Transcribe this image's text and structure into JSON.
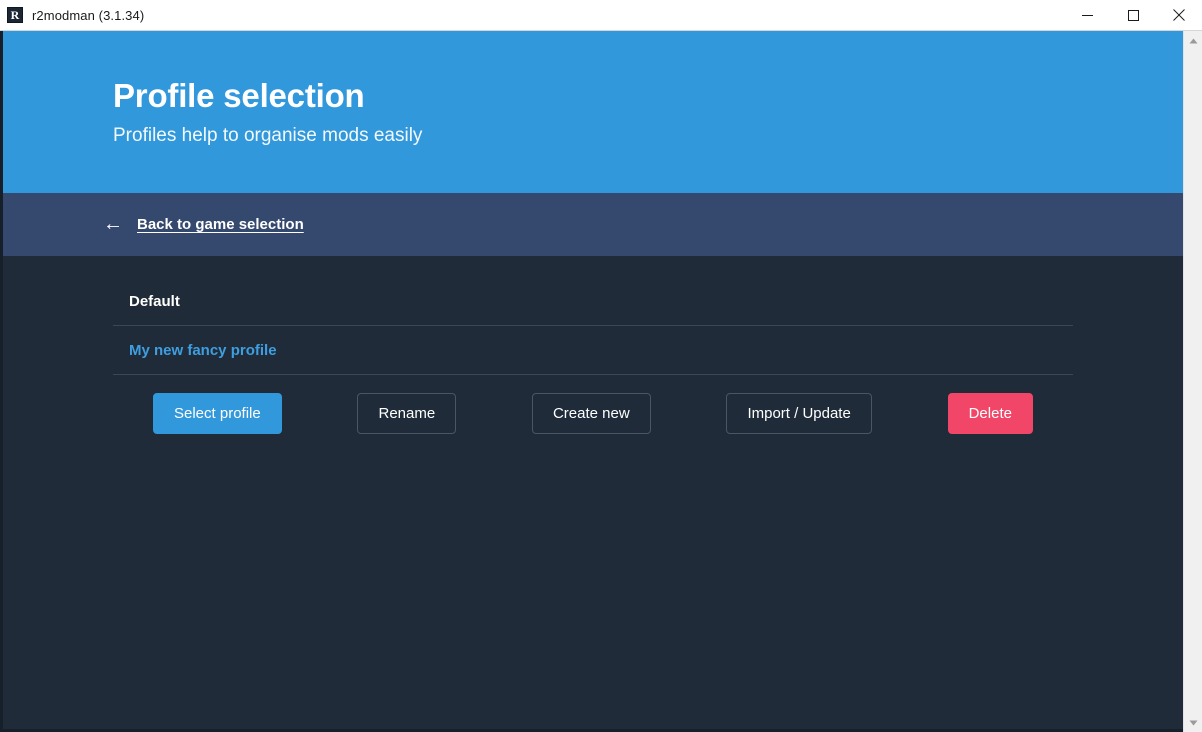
{
  "window": {
    "title": "r2modman (3.1.34)",
    "app_icon": "R",
    "controls": {
      "minimize": "minimize-icon",
      "maximize": "maximize-icon",
      "close": "close-icon"
    }
  },
  "hero": {
    "title": "Profile selection",
    "subtitle": "Profiles help to organise mods easily",
    "background_color": "#3298dc"
  },
  "navbar": {
    "back_arrow": "←",
    "back_label": "Back to game selection",
    "background_color": "#35486e"
  },
  "main": {
    "background_color": "#1f2b38",
    "profiles": [
      {
        "name": "Default",
        "selected": false
      },
      {
        "name": "My new fancy profile",
        "selected": true
      }
    ],
    "buttons": [
      {
        "label": "Select profile",
        "style": "primary",
        "color": "#3298dc"
      },
      {
        "label": "Rename",
        "style": "ghost",
        "color": "#4a5663"
      },
      {
        "label": "Create new",
        "style": "ghost",
        "color": "#4a5663"
      },
      {
        "label": "Import / Update",
        "style": "ghost",
        "color": "#4a5663"
      },
      {
        "label": "Delete",
        "style": "danger",
        "color": "#f14668"
      }
    ]
  },
  "scrollbar": {
    "up_arrow": "scroll-up-icon",
    "down_arrow": "scroll-down-icon"
  }
}
